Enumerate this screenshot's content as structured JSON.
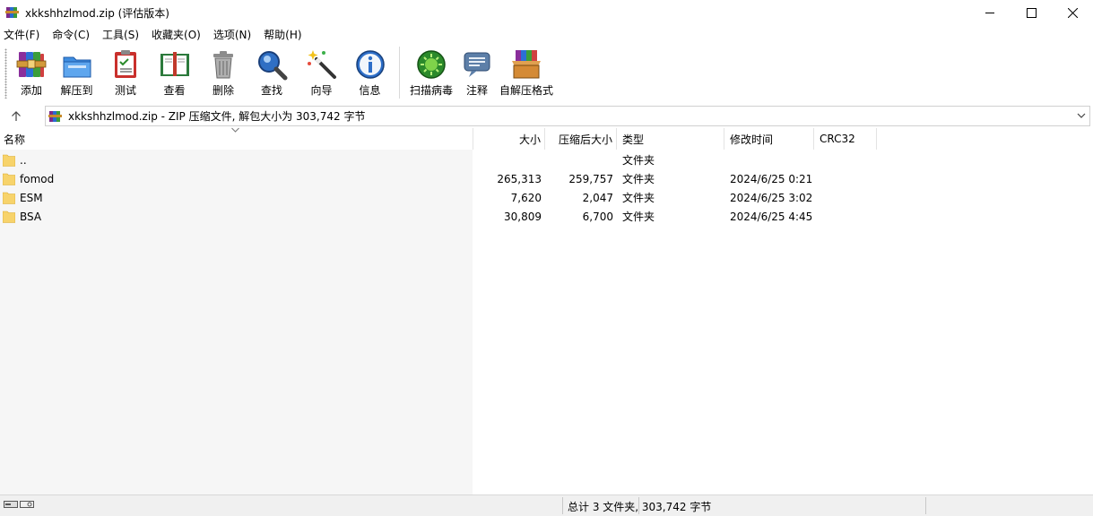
{
  "window": {
    "title": "xkkshhzlmod.zip (评估版本)"
  },
  "menu": [
    "文件(F)",
    "命令(C)",
    "工具(S)",
    "收藏夹(O)",
    "选项(N)",
    "帮助(H)"
  ],
  "toolbar": [
    {
      "label": "添加",
      "icon": "add-archive-icon"
    },
    {
      "label": "解压到",
      "icon": "extract-to-icon"
    },
    {
      "label": "测试",
      "icon": "test-icon"
    },
    {
      "label": "查看",
      "icon": "view-book-icon"
    },
    {
      "label": "删除",
      "icon": "trash-icon"
    },
    {
      "label": "查找",
      "icon": "magnifier-icon"
    },
    {
      "label": "向导",
      "icon": "wizard-wand-icon"
    },
    {
      "label": "信息",
      "icon": "info-icon"
    },
    {
      "label": "扫描病毒",
      "icon": "virus-scan-icon"
    },
    {
      "label": "注释",
      "icon": "comment-icon"
    },
    {
      "label": "自解压格式",
      "icon": "sfx-box-icon"
    }
  ],
  "address": {
    "text": "xkkshhzlmod.zip - ZIP 压缩文件, 解包大小为 303,742 字节"
  },
  "columns": {
    "name": "名称",
    "size": "大小",
    "packed": "压缩后大小",
    "type": "类型",
    "modified": "修改时间",
    "crc": "CRC32"
  },
  "rows": [
    {
      "name": "..",
      "size": "",
      "packed": "",
      "type": "文件夹",
      "modified": ""
    },
    {
      "name": "fomod",
      "size": "265,313",
      "packed": "259,757",
      "type": "文件夹",
      "modified": "2024/6/25 0:21"
    },
    {
      "name": "ESM",
      "size": "7,620",
      "packed": "2,047",
      "type": "文件夹",
      "modified": "2024/6/25 3:02"
    },
    {
      "name": "BSA",
      "size": "30,809",
      "packed": "6,700",
      "type": "文件夹",
      "modified": "2024/6/25 4:45"
    }
  ],
  "status": {
    "text": "总计 3 文件夹, 303,742 字节"
  },
  "colors": {
    "folder": "#f7d36b",
    "selection_bg": "#f6f6f6"
  }
}
